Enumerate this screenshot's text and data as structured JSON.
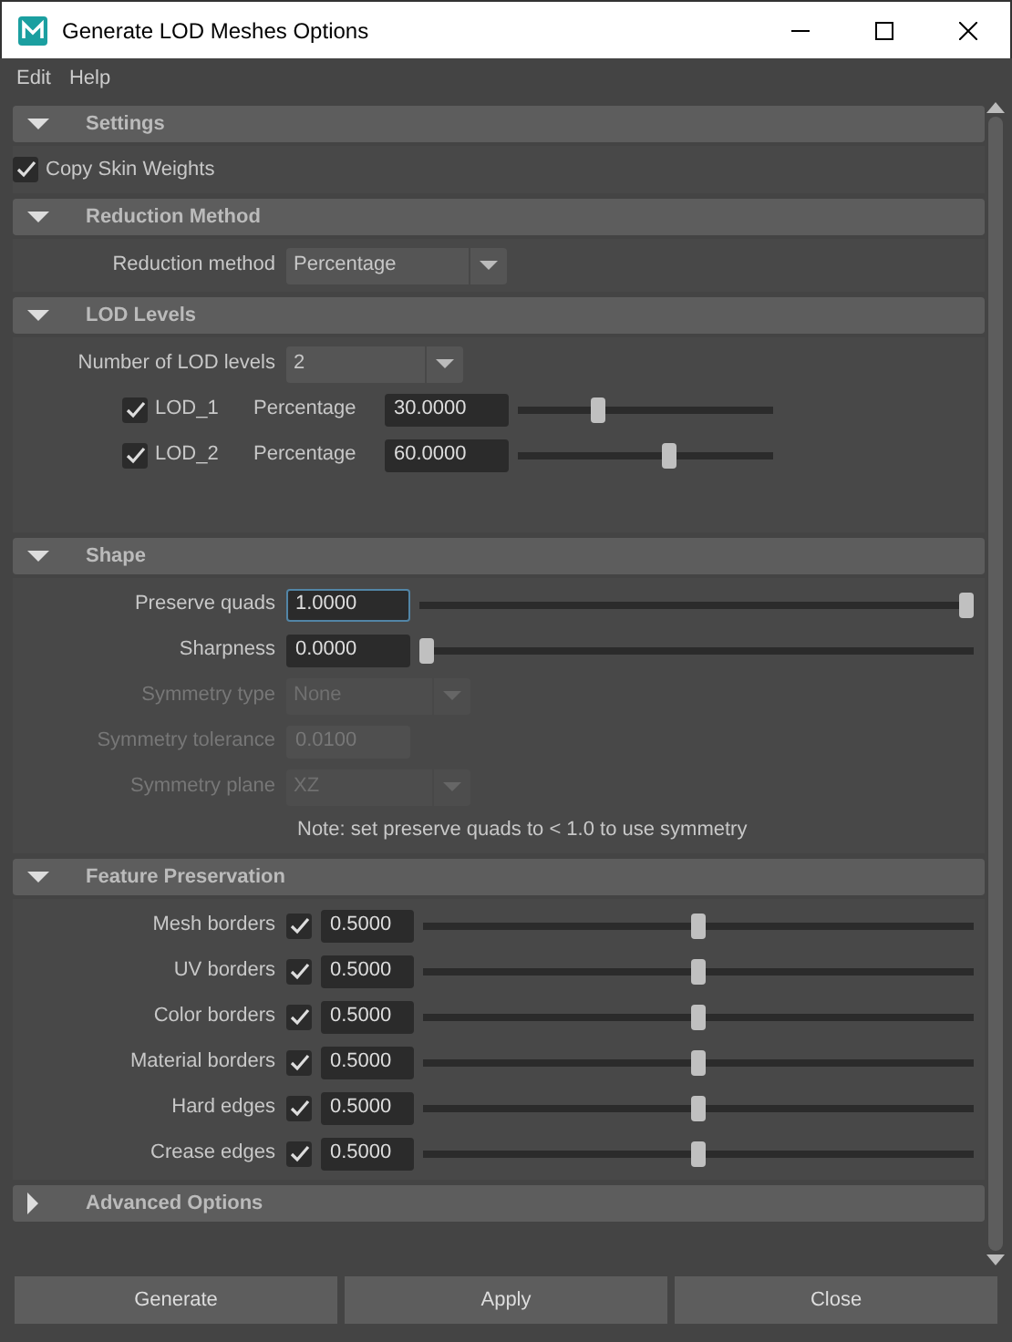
{
  "window": {
    "title": "Generate LOD Meshes Options"
  },
  "menu": [
    "Edit",
    "Help"
  ],
  "sections": [
    {
      "title": "Settings",
      "expanded": true,
      "rows": [
        {
          "kind": "checkbox",
          "label": "Copy Skin Weights",
          "checked": true
        }
      ]
    },
    {
      "title": "Reduction Method",
      "expanded": true,
      "rows": [
        {
          "kind": "dropdown",
          "label": "Reduction method",
          "value": "Percentage",
          "disabled": false
        }
      ]
    },
    {
      "title": "LOD Levels",
      "expanded": true,
      "rows": [
        {
          "kind": "dropdown",
          "label": "Number of LOD levels",
          "value": "2",
          "disabled": false
        },
        {
          "kind": "lod",
          "label": "LOD_1",
          "checked": true,
          "field_label": "Percentage",
          "value": "30.0000",
          "level": 0.3
        },
        {
          "kind": "lod",
          "label": "LOD_2",
          "checked": true,
          "field_label": "Percentage",
          "value": "60.0000",
          "level": 0.6
        }
      ]
    },
    {
      "title": "Shape",
      "expanded": true,
      "rows": [
        {
          "kind": "slider",
          "label": "Preserve quads",
          "value": "1.0000",
          "level": 1,
          "focused": true
        },
        {
          "kind": "slider",
          "label": "Sharpness",
          "value": "0.0000",
          "level": 0,
          "focused": false
        },
        {
          "kind": "dropdown",
          "label": "Symmetry type",
          "value": "None",
          "disabled": true
        },
        {
          "kind": "field",
          "label": "Symmetry tolerance",
          "value": "0.0100",
          "disabled": true
        },
        {
          "kind": "dropdown",
          "label": "Symmetry plane",
          "value": "XZ",
          "disabled": true
        },
        {
          "kind": "note",
          "text": "Note: set preserve quads to < 1.0 to use symmetry"
        }
      ]
    },
    {
      "title": "Feature Preservation",
      "expanded": true,
      "rows": [
        {
          "kind": "feature",
          "label": "Mesh borders",
          "checked": true,
          "value": "0.5000",
          "level": 0.5
        },
        {
          "kind": "feature",
          "label": "UV borders",
          "checked": true,
          "value": "0.5000",
          "level": 0.5
        },
        {
          "kind": "feature",
          "label": "Color borders",
          "checked": true,
          "value": "0.5000",
          "level": 0.5
        },
        {
          "kind": "feature",
          "label": "Material borders",
          "checked": true,
          "value": "0.5000",
          "level": 0.5
        },
        {
          "kind": "feature",
          "label": "Hard edges",
          "checked": true,
          "value": "0.5000",
          "level": 0.5
        },
        {
          "kind": "feature",
          "label": "Crease edges",
          "checked": true,
          "value": "0.5000",
          "level": 0.5
        }
      ]
    },
    {
      "title": "Advanced Options",
      "expanded": false
    }
  ],
  "buttons": [
    "Generate",
    "Apply",
    "Close"
  ]
}
